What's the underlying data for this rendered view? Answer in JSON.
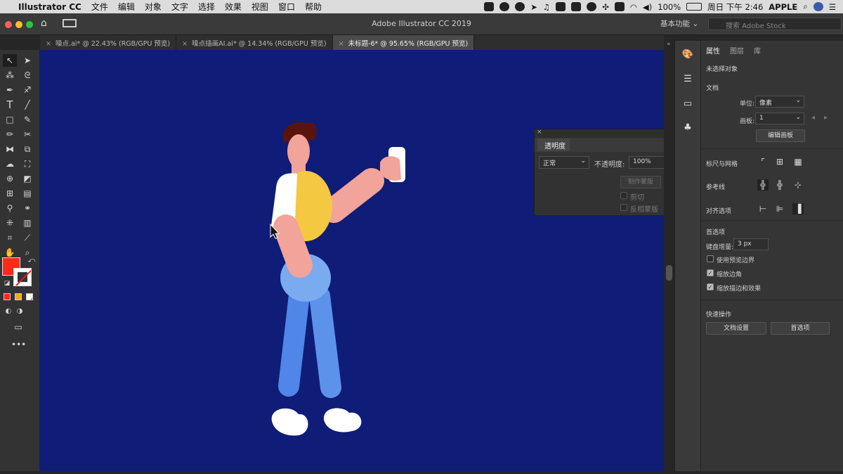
{
  "menubar": {
    "app_name": "Illustrator CC",
    "items": [
      "文件",
      "编辑",
      "对象",
      "文字",
      "选择",
      "效果",
      "视图",
      "窗口",
      "帮助"
    ],
    "battery": "100%",
    "clock": "周日 下午 2:46",
    "user": "APPLE"
  },
  "titlebar": {
    "title": "Adobe Illustrator CC 2019",
    "workspace": "基本功能",
    "stock_placeholder": "搜索 Adobe Stock"
  },
  "tabs": [
    {
      "label": "噪点.ai* @ 22.43% (RGB/GPU 预览)"
    },
    {
      "label": "噪点插画AI.ai* @ 14.34% (RGB/GPU 预览)"
    },
    {
      "label": "未标题-6* @ 95.65% (RGB/GPU 预览)"
    }
  ],
  "colors": {
    "canvas": "#0f1c78",
    "fill": "#ff2a1a",
    "skin": "#f2a39a",
    "hair": "#5a140e",
    "shirt": "#f5c842",
    "pants_light": "#7aaaf0",
    "pants_dark": "#4f86e8"
  },
  "transparency": {
    "title": "透明度",
    "mode": "正常",
    "opacity_label": "不透明度:",
    "opacity_value": "100%",
    "make_mask": "制作蒙版",
    "clip": "剪切",
    "invert": "反相蒙版"
  },
  "properties": {
    "tabs": [
      "属性",
      "图层",
      "库"
    ],
    "no_selection": "未选择对象",
    "document": "文档",
    "unit_label": "单位:",
    "unit_value": "像素",
    "artboard_label": "画板:",
    "artboard_value": "1",
    "edit_artboards": "编辑画板",
    "rulers_grids": "标尺与网格",
    "guides": "参考线",
    "align": "对齐选项",
    "preferences": "首选项",
    "keyboard_increment_label": "键盘增量:",
    "keyboard_increment_value": "3 px",
    "use_preview_bounds": "使用预览边界",
    "scale_corners": "缩放边角",
    "scale_strokes": "缩放描边和效果",
    "quick_actions": "快速操作",
    "doc_setup": "文档设置",
    "prefs_button": "首选项"
  }
}
